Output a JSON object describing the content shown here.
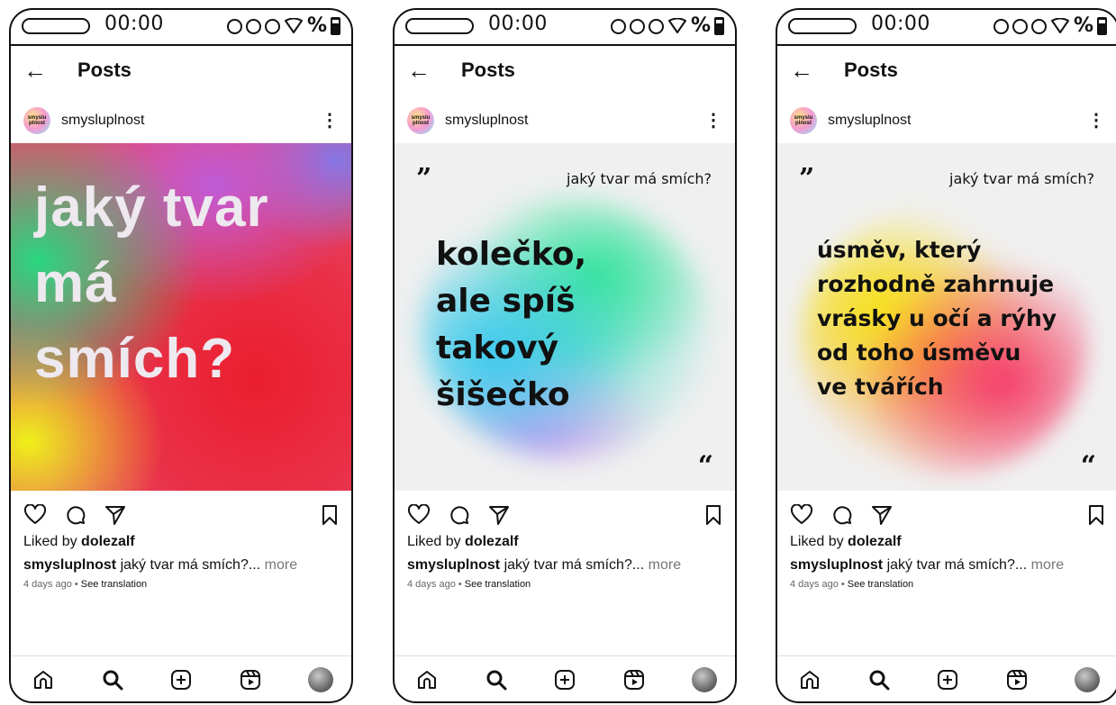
{
  "status": {
    "time": "00:00",
    "battery_symbol": "%"
  },
  "header": {
    "back_icon": "←",
    "title": "Posts"
  },
  "user": {
    "username": "smysluplnost",
    "avatar_text": "smyslu plnost"
  },
  "posts": [
    {
      "big_text_lines": [
        "jaký tvar",
        "má",
        "smích?"
      ]
    },
    {
      "open_quote": "”",
      "question": "jaký tvar má smích?",
      "answer_lines": [
        "kolečko,",
        "ale spíš",
        "takový",
        "šišečko"
      ],
      "close_quote": "“"
    },
    {
      "open_quote": "”",
      "question": "jaký tvar má smích?",
      "answer_lines": [
        "úsměv, který",
        "rozhodně zahrnuje",
        "vrásky u očí a rýhy",
        "od toho úsměvu",
        "ve tvářích"
      ],
      "close_quote": "“"
    }
  ],
  "feed": {
    "liked_prefix": "Liked by",
    "liked_user": "dolezalf",
    "caption_user": "smysluplnost",
    "caption_text": " jaký tvar má smích?...",
    "more": " more",
    "time_ago": "4 days ago",
    "separator": " • ",
    "see_translation": "See translation"
  },
  "icons": {
    "actions": [
      "heart-icon",
      "comment-icon",
      "share-icon",
      "bookmark-icon"
    ],
    "nav": [
      "home-icon",
      "search-icon",
      "create-icon",
      "reels-icon",
      "profile-avatar"
    ]
  }
}
